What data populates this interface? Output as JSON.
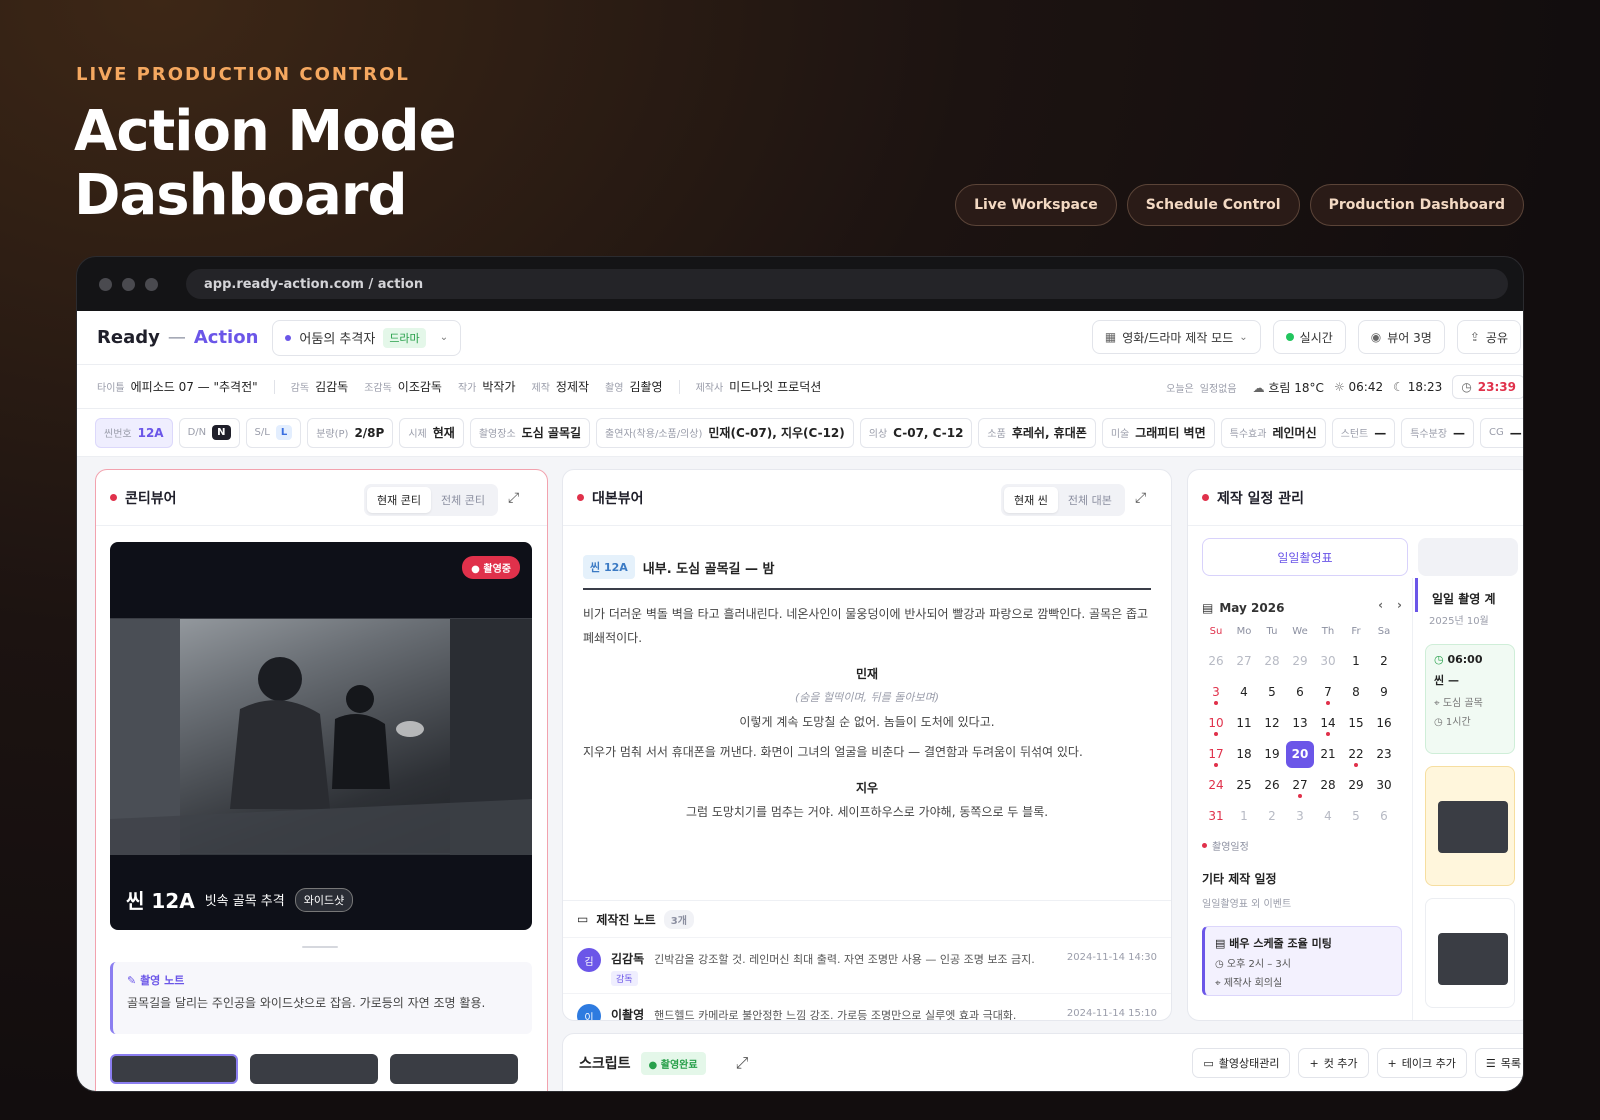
{
  "hero": {
    "eyebrow": "LIVE PRODUCTION CONTROL",
    "title_line1": "Action Mode",
    "title_line2": "Dashboard",
    "pills": [
      "Live Workspace",
      "Schedule Control",
      "Production Dashboard"
    ]
  },
  "browser": {
    "url": "app.ready-action.com / action"
  },
  "topbar": {
    "brand_ready": "Ready",
    "brand_dash": "—",
    "brand_action": "Action",
    "project_name": "어둠의 추격자",
    "project_tag": "드라마",
    "mode_label": "영화/드라마 제작 모드",
    "live_label": "실시간",
    "viewer_label": "뷰어 3명",
    "share_label": "공유"
  },
  "meta": {
    "title_k": "타이틀",
    "title_v": "에피소드 07 — \"추격전\"",
    "director_k": "감독",
    "director_v": "김감독",
    "assistant_k": "조감독",
    "assistant_v": "이조감독",
    "writer_k": "작가",
    "writer_v": "박작가",
    "producer_k": "제작",
    "producer_v": "정제작",
    "camera_k": "촬영",
    "camera_v": "김촬영",
    "company_k": "제작사",
    "company_v": "미드나잇 프로덕션",
    "today_k": "오늘은",
    "today_v": "일정없음",
    "weather": "흐림 18°C",
    "sunrise": "06:42",
    "sunset": "18:23",
    "clock": "23:39"
  },
  "chips": [
    {
      "k": "씬번호",
      "v": "12A",
      "style": "sel"
    },
    {
      "k": "D/N",
      "v": "N",
      "style": "n"
    },
    {
      "k": "S/L",
      "v": "L",
      "style": "l"
    },
    {
      "k": "분량(P)",
      "v": "2/8P"
    },
    {
      "k": "시제",
      "v": "현재"
    },
    {
      "k": "촬영장소",
      "v": "도심 골목길"
    },
    {
      "k": "출연자(착용/소품/의상)",
      "v": "민재(C-07), 지우(C-12)"
    },
    {
      "k": "의상",
      "v": "C-07, C-12"
    },
    {
      "k": "소품",
      "v": "후레쉬, 휴대폰"
    },
    {
      "k": "미술",
      "v": "그래피티 벽면"
    },
    {
      "k": "특수효과",
      "v": "레인머신"
    },
    {
      "k": "스턴트",
      "v": "—"
    },
    {
      "k": "특수분장",
      "v": "—"
    },
    {
      "k": "CG",
      "v": "—"
    }
  ],
  "conti": {
    "title": "콘티뷰어",
    "seg_current": "현재 콘티",
    "seg_all": "전체 콘티",
    "live_badge": "촬영중",
    "scene_no": "씬 12A",
    "scene_title": "빗속 골목 추격",
    "shot": "와이드샷",
    "note_head": "촬영 노트",
    "note_body": "골목길을 달리는 주인공을 와이드샷으로 잡음. 가로등의 자연 조명 활용."
  },
  "script": {
    "title": "대본뷰어",
    "seg_current": "현재 씬",
    "seg_all": "전체 대본",
    "scene_tag": "씬 12A",
    "scene_heading": "내부. 도심 골목길 — 밤",
    "action1": "비가 더러운 벽돌 벽을 타고 흘러내린다. 네온사인이 물웅덩이에 반사되어 빨강과 파랑으로 깜빡인다. 골목은 좁고 폐쇄적이다.",
    "char1": "민재",
    "paren1": "(숨을 헐떡이며, 뒤를 돌아보며)",
    "line1": "이렇게 계속 도망칠 순 없어. 놈들이 도처에 있다고.",
    "action2": "지우가 멈춰 서서 휴대폰을 꺼낸다. 화면이 그녀의 얼굴을 비춘다 — 결연함과 두려움이 뒤섞여 있다.",
    "char2": "지우",
    "line2": "그럼 도망치기를 멈추는 거야. 세이프하우스로 가야해, 동쪽으로 두 블록."
  },
  "crew_notes": {
    "title": "제작진 노트",
    "count": "3개",
    "items": [
      {
        "avatar": "김",
        "name": "김감독",
        "role": "감독",
        "text": "긴박감을 강조할 것. 레인머신 최대 출력. 자연 조명만 사용 — 인공 조명 보조 금지.",
        "time": "2024-11-14 14:30"
      },
      {
        "avatar": "이",
        "name": "이촬영",
        "text": "핸드헬드 카메라로 불안정한 느낌 강조. 가로등 조명만으로 실루엣 효과 극대화.",
        "time": "2024-11-14 15:10"
      }
    ]
  },
  "schedule": {
    "title": "제작 일정 관리",
    "daily_btn": "일일촬영표",
    "month": "May 2026",
    "weekdays": [
      "Su",
      "Mo",
      "Tu",
      "We",
      "Th",
      "Fr",
      "Sa"
    ],
    "days": [
      {
        "d": "26",
        "m": true
      },
      {
        "d": "27",
        "m": true
      },
      {
        "d": "28",
        "m": true
      },
      {
        "d": "29",
        "m": true
      },
      {
        "d": "30",
        "m": true
      },
      {
        "d": "1"
      },
      {
        "d": "2"
      },
      {
        "d": "3",
        "s": true,
        "e": true
      },
      {
        "d": "4"
      },
      {
        "d": "5"
      },
      {
        "d": "6"
      },
      {
        "d": "7",
        "e": true
      },
      {
        "d": "8"
      },
      {
        "d": "9"
      },
      {
        "d": "10",
        "s": true,
        "e": true
      },
      {
        "d": "11"
      },
      {
        "d": "12"
      },
      {
        "d": "13"
      },
      {
        "d": "14",
        "e": true
      },
      {
        "d": "15"
      },
      {
        "d": "16"
      },
      {
        "d": "17",
        "s": true,
        "e": true
      },
      {
        "d": "18"
      },
      {
        "d": "19"
      },
      {
        "d": "20",
        "t": true
      },
      {
        "d": "21"
      },
      {
        "d": "22",
        "e": true
      },
      {
        "d": "23"
      },
      {
        "d": "24",
        "s": true
      },
      {
        "d": "25"
      },
      {
        "d": "26"
      },
      {
        "d": "27",
        "e": true
      },
      {
        "d": "28"
      },
      {
        "d": "29"
      },
      {
        "d": "30"
      },
      {
        "d": "31",
        "s": true
      },
      {
        "d": "1",
        "m": true
      },
      {
        "d": "2",
        "m": true
      },
      {
        "d": "3",
        "m": true
      },
      {
        "d": "4",
        "m": true
      },
      {
        "d": "5",
        "m": true
      },
      {
        "d": "6",
        "m": true
      }
    ],
    "legend": "촬영일정",
    "other_title": "기타 제작 일정",
    "other_sub": "일일촬영표 외 이벤트",
    "event_title": "배우 스케줄 조율 미팅",
    "event_time": "오후 2시 – 3시",
    "event_place": "제작사 회의실",
    "daily_head": "일일 촬영 계",
    "daily_sub": "2025년 10월",
    "card_time": "06:00",
    "card_scene": "씬 —",
    "card_place": "도심 골목",
    "card_dur": "1시간"
  },
  "bottom": {
    "title": "스크립트",
    "status": "촬영완료",
    "btn_status": "촬영상태관리",
    "btn_cut": "컷 추가",
    "btn_take": "테이크 추가",
    "btn_list": "목록"
  }
}
